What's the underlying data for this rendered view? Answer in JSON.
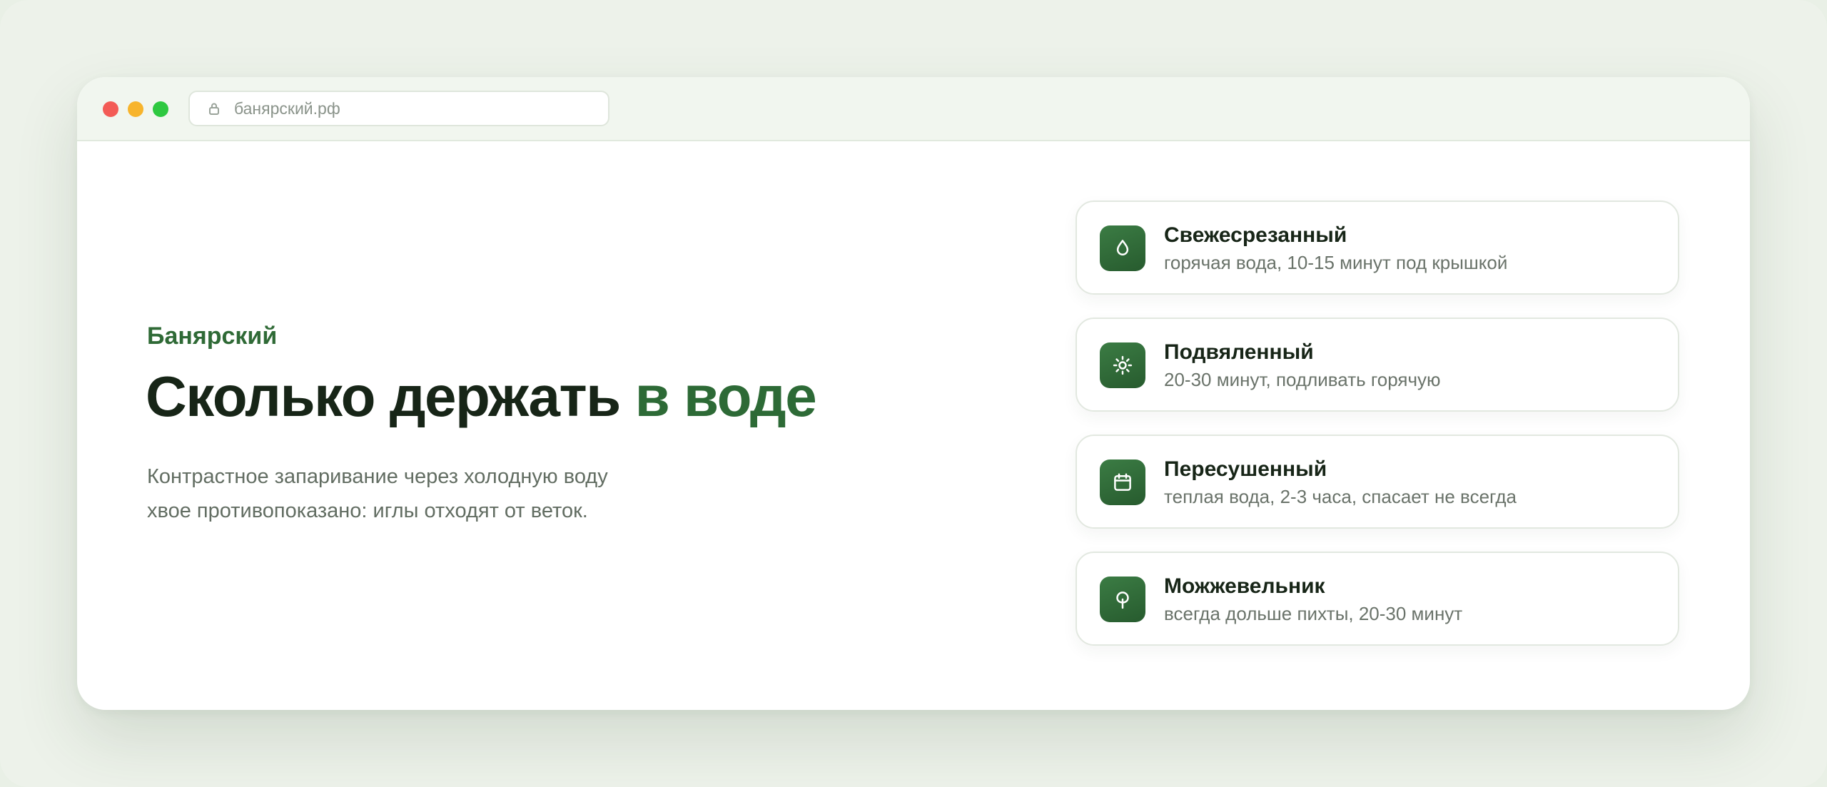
{
  "browser": {
    "url": "банярский.рф"
  },
  "hero": {
    "eyebrow": "Банярский",
    "headline_main": "Сколько держать ",
    "headline_accent": "в воде",
    "lead_line1": "Контрастное запаривание через холодную воду",
    "lead_line2": "хвое противопоказано: иглы отходят от веток."
  },
  "cards": [
    {
      "icon": "water-drop-icon",
      "title": "Свежесрезанный",
      "subtitle": "горячая вода, 10-15 минут под крышкой"
    },
    {
      "icon": "sun-icon",
      "title": "Подвяленный",
      "subtitle": "20-30 минут, подливать горячую"
    },
    {
      "icon": "calendar-icon",
      "title": "Пересушенный",
      "subtitle": "теплая вода, 2-3 часа, спасает не всегда"
    },
    {
      "icon": "tree-icon",
      "title": "Можжевельник",
      "subtitle": "всегда дольше пихты, 20-30 минут"
    }
  ],
  "colors": {
    "accent": "#2d6a36",
    "heading": "#172517",
    "page_bg": "#edf2ea",
    "traffic_red": "#f35b56",
    "traffic_yellow": "#f7b42c",
    "traffic_green": "#2ec840"
  }
}
